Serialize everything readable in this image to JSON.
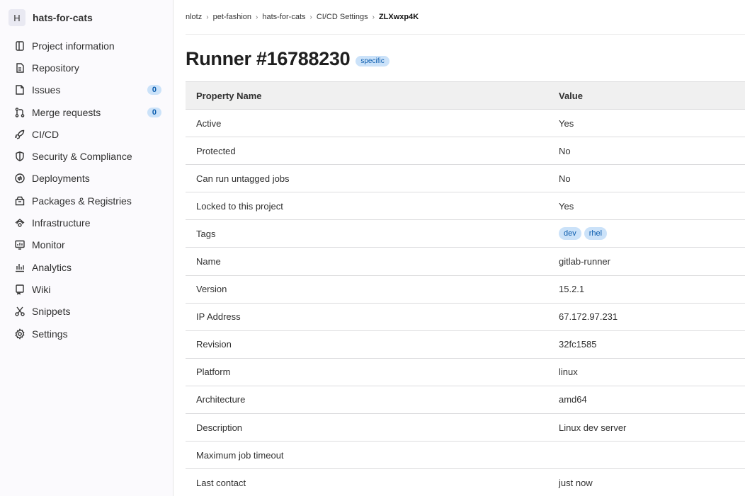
{
  "project": {
    "avatar_letter": "H",
    "name": "hats-for-cats"
  },
  "sidebar": {
    "items": [
      {
        "label": "Project information",
        "icon": "project-info-icon"
      },
      {
        "label": "Repository",
        "icon": "repository-icon"
      },
      {
        "label": "Issues",
        "icon": "issues-icon",
        "badge": "0"
      },
      {
        "label": "Merge requests",
        "icon": "merge-request-icon",
        "badge": "0"
      },
      {
        "label": "CI/CD",
        "icon": "rocket-icon"
      },
      {
        "label": "Security & Compliance",
        "icon": "shield-icon"
      },
      {
        "label": "Deployments",
        "icon": "deployments-icon"
      },
      {
        "label": "Packages & Registries",
        "icon": "package-icon"
      },
      {
        "label": "Infrastructure",
        "icon": "cloud-icon"
      },
      {
        "label": "Monitor",
        "icon": "monitor-icon"
      },
      {
        "label": "Analytics",
        "icon": "chart-icon"
      },
      {
        "label": "Wiki",
        "icon": "book-icon"
      },
      {
        "label": "Snippets",
        "icon": "scissors-icon"
      },
      {
        "label": "Settings",
        "icon": "gear-icon"
      }
    ]
  },
  "breadcrumb": {
    "items": [
      "nlotz",
      "pet-fashion",
      "hats-for-cats",
      "CI/CD Settings"
    ],
    "current": "ZLXwxp4K"
  },
  "page": {
    "title": "Runner #16788230",
    "badge": "specific"
  },
  "table": {
    "headers": [
      "Property Name",
      "Value"
    ],
    "rows": [
      {
        "name": "Active",
        "value": "Yes"
      },
      {
        "name": "Protected",
        "value": "No"
      },
      {
        "name": "Can run untagged jobs",
        "value": "No"
      },
      {
        "name": "Locked to this project",
        "value": "Yes"
      },
      {
        "name": "Tags",
        "tags": [
          "dev",
          "rhel"
        ]
      },
      {
        "name": "Name",
        "value": "gitlab-runner"
      },
      {
        "name": "Version",
        "value": "15.2.1"
      },
      {
        "name": "IP Address",
        "value": "67.172.97.231"
      },
      {
        "name": "Revision",
        "value": "32fc1585"
      },
      {
        "name": "Platform",
        "value": "linux"
      },
      {
        "name": "Architecture",
        "value": "amd64"
      },
      {
        "name": "Description",
        "value": "Linux dev server"
      },
      {
        "name": "Maximum job timeout",
        "value": ""
      },
      {
        "name": "Last contact",
        "value": "just now"
      }
    ]
  },
  "colors": {
    "accent": "#cbe2f9",
    "accent_text": "#0b5cad",
    "sidebar_bg": "#fbfafd",
    "table_header_bg": "#f0f0f0"
  }
}
